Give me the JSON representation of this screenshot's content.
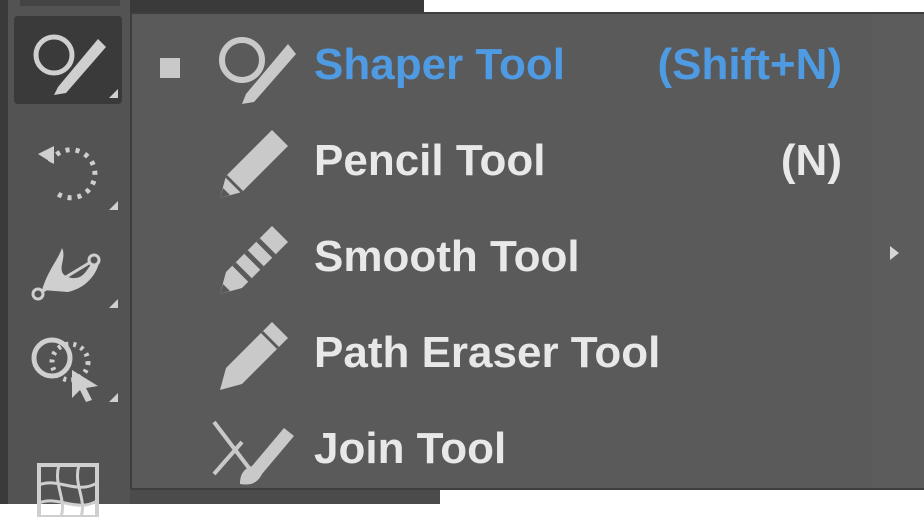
{
  "toolbar": {
    "tools": [
      {
        "icon": "shaper-icon",
        "active": true
      },
      {
        "icon": "rotate-icon",
        "active": false
      },
      {
        "icon": "puppet-warp-icon",
        "active": false
      },
      {
        "icon": "shape-builder-icon",
        "active": false
      },
      {
        "icon": "mesh-icon",
        "active": false
      }
    ]
  },
  "flyout": {
    "items": [
      {
        "label": "Shaper Tool",
        "shortcut": "(Shift+N)",
        "icon": "shaper-icon",
        "selected": true
      },
      {
        "label": "Pencil Tool",
        "shortcut": "(N)",
        "icon": "pencil-icon",
        "selected": false
      },
      {
        "label": "Smooth Tool",
        "shortcut": "",
        "icon": "smooth-icon",
        "selected": false
      },
      {
        "label": "Path Eraser Tool",
        "shortcut": "",
        "icon": "path-eraser-icon",
        "selected": false
      },
      {
        "label": "Join Tool",
        "shortcut": "",
        "icon": "join-icon",
        "selected": false
      }
    ],
    "tearoff_icon": "tearoff-arrow-icon"
  },
  "colors": {
    "selected_text": "#4f9be3",
    "text": "#e8e8e8",
    "panel": "#5a5a5a",
    "toolbar": "#535353"
  }
}
